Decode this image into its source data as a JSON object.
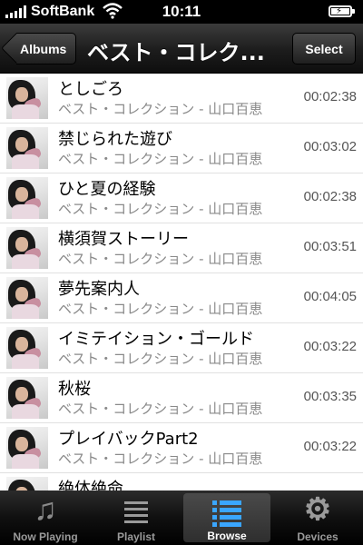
{
  "status_bar": {
    "carrier": "SoftBank",
    "time": "10:11"
  },
  "nav": {
    "back_label": "Albums",
    "title": "ベスト・コレク...",
    "select_label": "Select"
  },
  "tracks": [
    {
      "title": "としごろ",
      "subtitle": "ベスト・コレクション - 山口百恵",
      "duration": "00:02:38"
    },
    {
      "title": "禁じられた遊び",
      "subtitle": "ベスト・コレクション - 山口百恵",
      "duration": "00:03:02"
    },
    {
      "title": "ひと夏の経験",
      "subtitle": "ベスト・コレクション - 山口百恵",
      "duration": "00:02:38"
    },
    {
      "title": "横須賀ストーリー",
      "subtitle": "ベスト・コレクション - 山口百恵",
      "duration": "00:03:51"
    },
    {
      "title": "夢先案内人",
      "subtitle": "ベスト・コレクション - 山口百恵",
      "duration": "00:04:05"
    },
    {
      "title": "イミテイション・ゴールド",
      "subtitle": "ベスト・コレクション - 山口百恵",
      "duration": "00:03:22"
    },
    {
      "title": "秋桜",
      "subtitle": "ベスト・コレクション - 山口百恵",
      "duration": "00:03:35"
    },
    {
      "title": "プレイバックPart2",
      "subtitle": "ベスト・コレクション - 山口百恵",
      "duration": "00:03:22"
    },
    {
      "title": "絶体絶命",
      "subtitle": "",
      "duration": ""
    }
  ],
  "tabs": [
    {
      "label": "Now Playing",
      "icon": "music-note-icon"
    },
    {
      "label": "Playlist",
      "icon": "playlist-icon"
    },
    {
      "label": "Browse",
      "icon": "browse-list-icon"
    },
    {
      "label": "Devices",
      "icon": "gear-icon"
    }
  ],
  "colors": {
    "accent_blue": "#3aa6ff",
    "nav_bg": "#1c1c1c",
    "secondary_text": "#8a8a8a"
  }
}
